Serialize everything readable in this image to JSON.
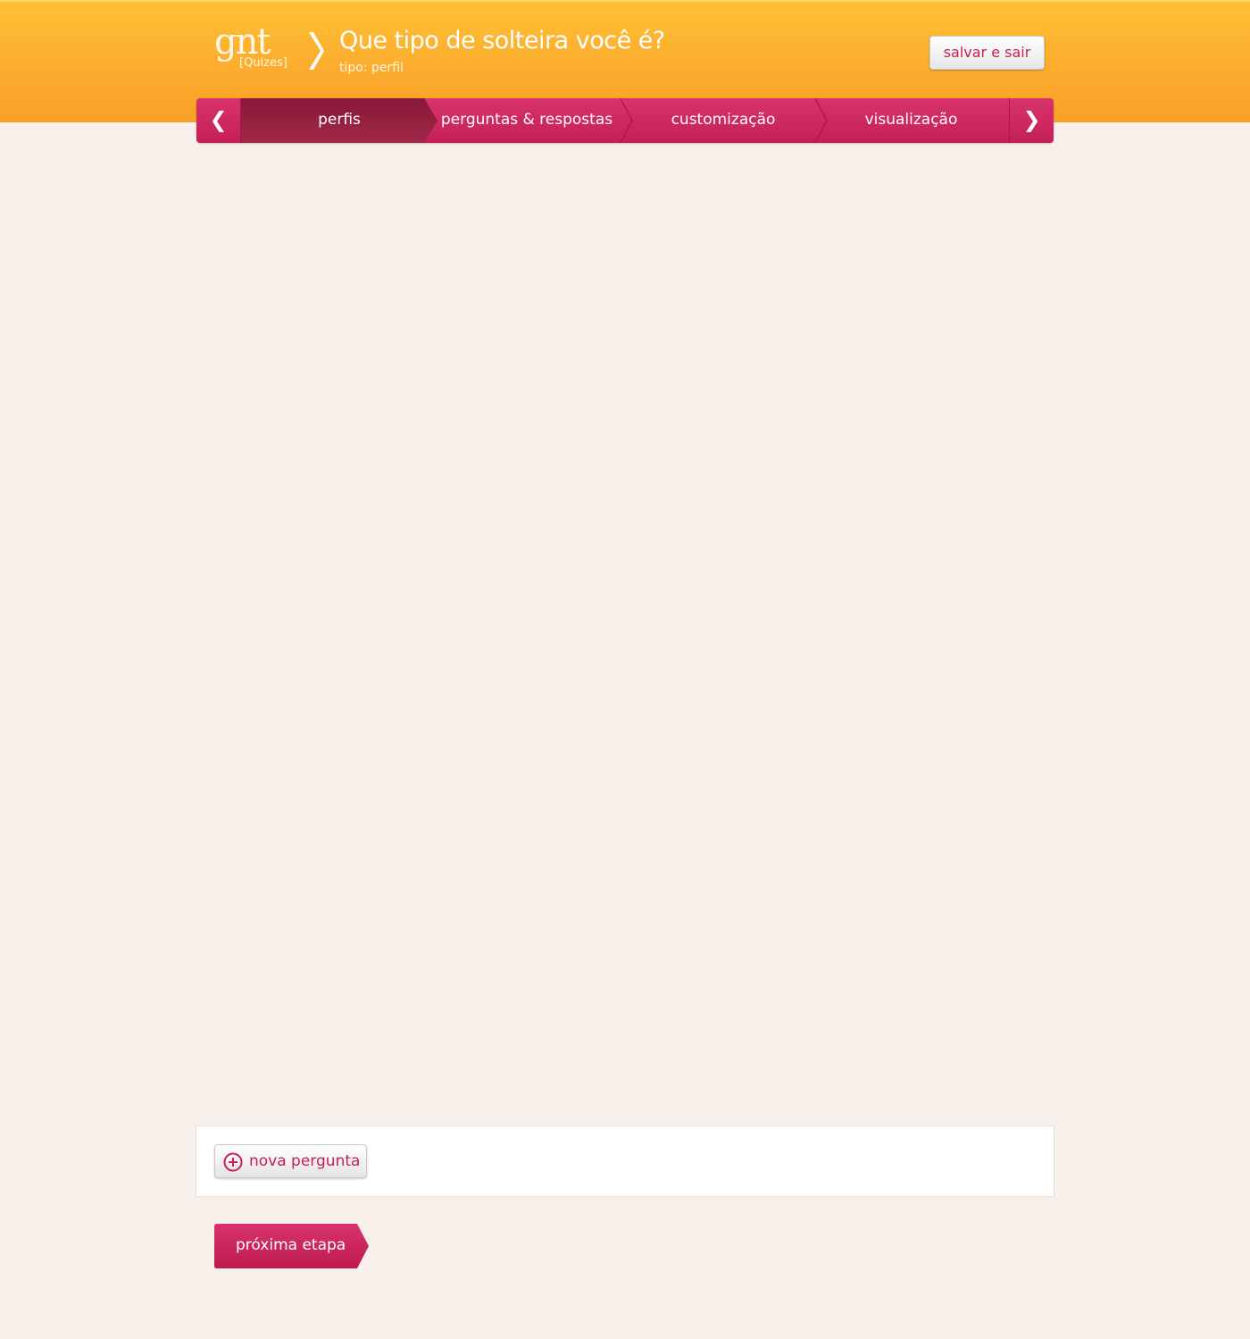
{
  "header": {
    "logo_word": "gnt",
    "logo_sub": "[Quizes]",
    "title": "Que tipo de solteira você é?",
    "subtitle": "tipo: perfil",
    "save_label": "salvar e sair"
  },
  "steps": {
    "prev_glyph": "❮",
    "next_glyph": "❯",
    "items": [
      {
        "label": "perfis",
        "active": true
      },
      {
        "label": "perguntas & respostas",
        "active": false
      },
      {
        "label": "customização",
        "active": false
      },
      {
        "label": "visualização",
        "active": false
      }
    ]
  },
  "actions": {
    "new_question_label": "nova pergunta",
    "next_step_label": "próxima etapa"
  },
  "colors": {
    "brand_orange": "#fcb02f",
    "brand_pink": "#c62054",
    "background": "#f8f0ea"
  },
  "icons": [
    "chevron-right-icon",
    "arrow-left-icon",
    "arrow-right-icon",
    "plus-circle-icon"
  ]
}
